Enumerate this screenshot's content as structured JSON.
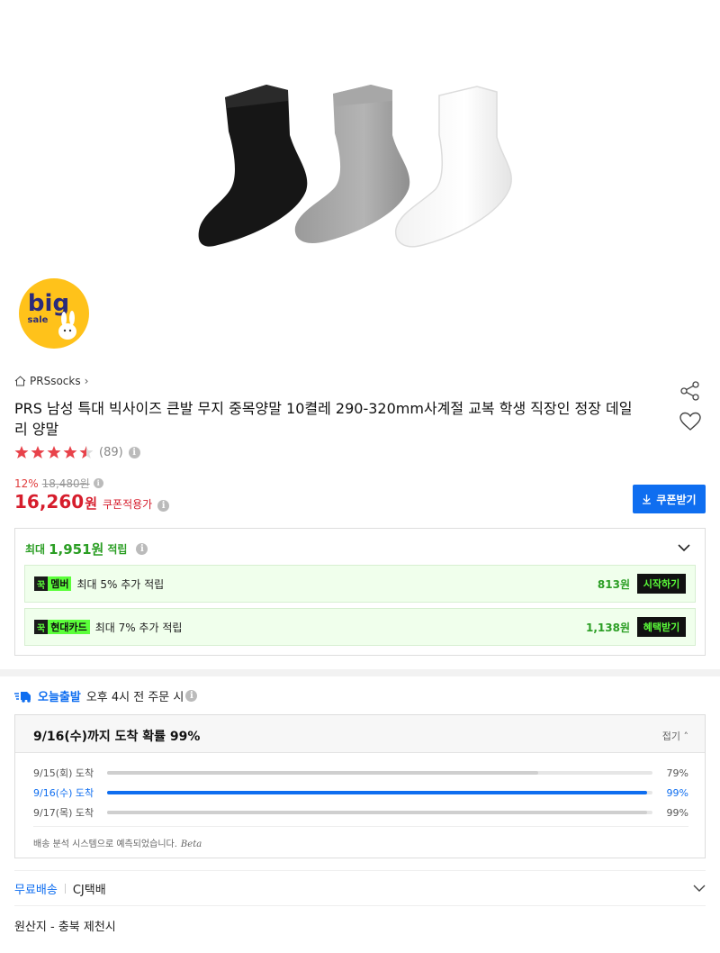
{
  "product": {
    "brand": "PRSsocks",
    "title": "PRS 남성 특대 빅사이즈 큰발 무지 중목양말 10켤레 290-320mm사계절 교복 학생 직장인 정장 데일리 양말",
    "rating": 4.5,
    "review_count": "(89)",
    "discount_pct": "12%",
    "original_price": "18,480원",
    "price": "16,260",
    "price_unit": "원",
    "price_tag": "쿠폰적용가",
    "coupon_button": "쿠폰받기",
    "icons": {
      "home": "home-icon",
      "share": "share-icon",
      "wishlist": "heart-icon",
      "info": "info-icon"
    },
    "badge": {
      "line1": "big",
      "line2": "sale"
    }
  },
  "reward": {
    "prefix": "최대",
    "amount": "1,951원",
    "suffix": "적립",
    "rows": [
      {
        "logo": "꾹",
        "name": "멤버",
        "desc": "최대 5% 추가 적립",
        "amount": "813원",
        "button": "시작하기"
      },
      {
        "logo": "꾹",
        "name": "현대카드",
        "desc": "최대 7% 추가 적립",
        "amount": "1,138원",
        "button": "혜택받기"
      }
    ]
  },
  "delivery": {
    "today_label": "오늘출발",
    "today_desc": "오후 4시 전 주문 시",
    "headline": "9/16(수)까지 도착 확률 99%",
    "fold_label": "접기",
    "rows": [
      {
        "label": "9/15(회) 도착",
        "pct": "79%",
        "value": 0.79,
        "active": false
      },
      {
        "label": "9/16(수) 도착",
        "pct": "99%",
        "value": 0.99,
        "active": true
      },
      {
        "label": "9/17(목) 도착",
        "pct": "99%",
        "value": 0.99,
        "active": false
      }
    ],
    "note": "배송 분석 시스템으로 예측되었습니다.",
    "note_beta": "Beta"
  },
  "shipping": {
    "free": "무료배송",
    "carrier": "CJ택배"
  },
  "origin": "원산지 - 충북 제천시",
  "colors": {
    "accent": "#0f6ef0",
    "price_red": "#d61d2c",
    "star": "#e8424a",
    "reward_green": "#2b9e24",
    "neon": "#5bff3a"
  }
}
